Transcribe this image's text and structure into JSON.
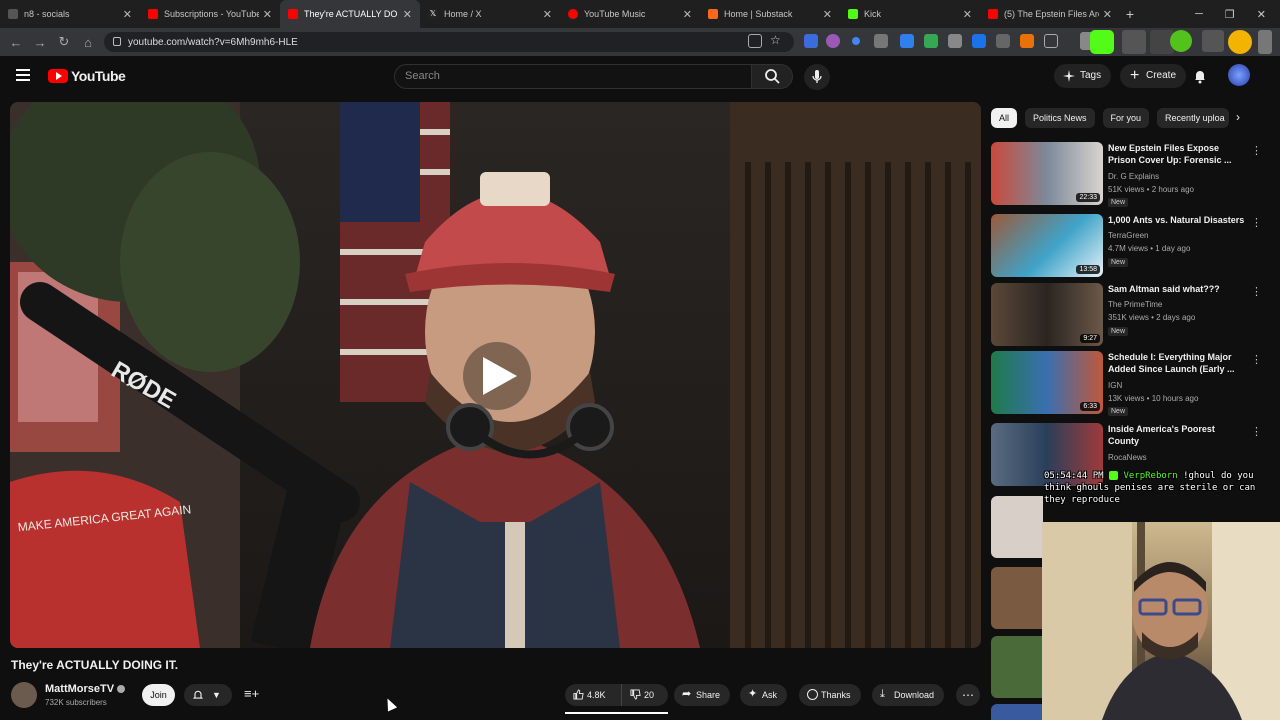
{
  "browser": {
    "tabs": [
      {
        "title": "n8 - socials",
        "color": "#555555"
      },
      {
        "title": "Subscriptions - YouTube",
        "color": "#ff0000"
      },
      {
        "title": "They're ACTUALLY DO",
        "color": "#ff0000"
      },
      {
        "title": "Home / X",
        "color": "#222222"
      },
      {
        "title": "YouTube Music",
        "color": "#ff0000"
      },
      {
        "title": "Home | Substack",
        "color": "#ff6719"
      },
      {
        "title": "Kick",
        "color": "#53fc18"
      },
      {
        "title": "(5) The Epstein Files Are S",
        "color": "#ff0000"
      }
    ],
    "url": "youtube.com/watch?v=6Mh9mh6-HLE"
  },
  "youtube": {
    "logo_text": "YouTube",
    "search_placeholder": "Search",
    "tags_label": "Tags",
    "create_label": "Create"
  },
  "video": {
    "title": "They're ACTUALLY DOING IT.",
    "channel_name": "MattMorseTV",
    "subscribers": "732K subscribers",
    "join_label": "Join",
    "likes": "4.8K",
    "dislikes": "20",
    "share_label": "Share",
    "ask_label": "Ask",
    "thanks_label": "Thanks",
    "download_label": "Download",
    "mic_brand": "RØDE",
    "hat_text": "MAKE AMERICA GREAT AGAIN"
  },
  "filters": [
    "All",
    "Politics News",
    "For you",
    "Recently uploa"
  ],
  "recommendations": [
    {
      "title": "New Epstein Files Expose Prison Cover Up: Forensic ...",
      "channel": "Dr. G Explains",
      "meta": "51K views • 2 hours ago",
      "badge": "New",
      "duration": "22:33",
      "thumb": "#c94a3b"
    },
    {
      "title": "1,000 Ants vs. Natural Disasters",
      "channel": "TerraGreen",
      "meta": "4.7M views • 1 day ago",
      "badge": "New",
      "duration": "13:58",
      "thumb": "#3fa3c9"
    },
    {
      "title": "Sam Altman said what???",
      "channel": "The PrimeTime",
      "meta": "351K views • 2 days ago",
      "badge": "New",
      "duration": "9:27",
      "thumb": "#4a3a2e"
    },
    {
      "title": "Schedule I: Everything Major Added Since Launch (Early ...",
      "channel": "IGN",
      "meta": "13K views • 10 hours ago",
      "badge": "New",
      "duration": "6:33",
      "thumb": "#3a6fb0"
    },
    {
      "title": "Inside America's Poorest County",
      "channel": "RocaNews",
      "meta": "",
      "badge": "",
      "duration": "",
      "thumb": "#2a3f5a"
    }
  ],
  "chat_overlay": {
    "timestamp": "05:54:44 PM",
    "user": "VerpReborn",
    "message": "!ghoul do you think ghouls penises are sterile or can they reproduce"
  },
  "colors": {
    "background": "#0f0f0f",
    "accent_red": "#ff0000",
    "chip_selected": "#f1f1f1"
  }
}
